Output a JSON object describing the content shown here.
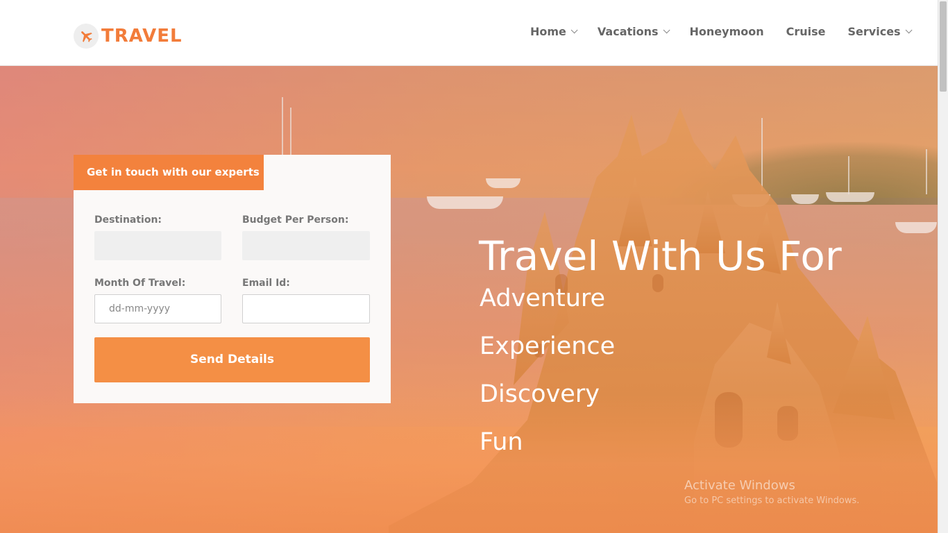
{
  "brand": {
    "name": "TRAVEL",
    "icon": "airplane-icon",
    "accent": "#f27c3a"
  },
  "nav": {
    "items": [
      {
        "label": "Home",
        "has_dropdown": true
      },
      {
        "label": "Vacations",
        "has_dropdown": true
      },
      {
        "label": "Honeymoon",
        "has_dropdown": false
      },
      {
        "label": "Cruise",
        "has_dropdown": false
      },
      {
        "label": "Services",
        "has_dropdown": true
      }
    ]
  },
  "form": {
    "tab_label": "Get in touch with our experts",
    "destination_label": "Destination:",
    "destination_value": "",
    "budget_label": "Budget Per Person:",
    "budget_value": "",
    "month_label": "Month Of Travel:",
    "month_placeholder": "dd-mm-yyyy",
    "email_label": "Email Id:",
    "email_value": "",
    "submit_label": "Send Details",
    "button_color": "#f48f45"
  },
  "hero": {
    "title": "Travel With Us For",
    "items": [
      "Adventure",
      "Experience",
      "Discovery",
      "Fun"
    ]
  },
  "watermark": {
    "line1": "Activate Windows",
    "line2": "Go to PC settings to activate Windows."
  }
}
